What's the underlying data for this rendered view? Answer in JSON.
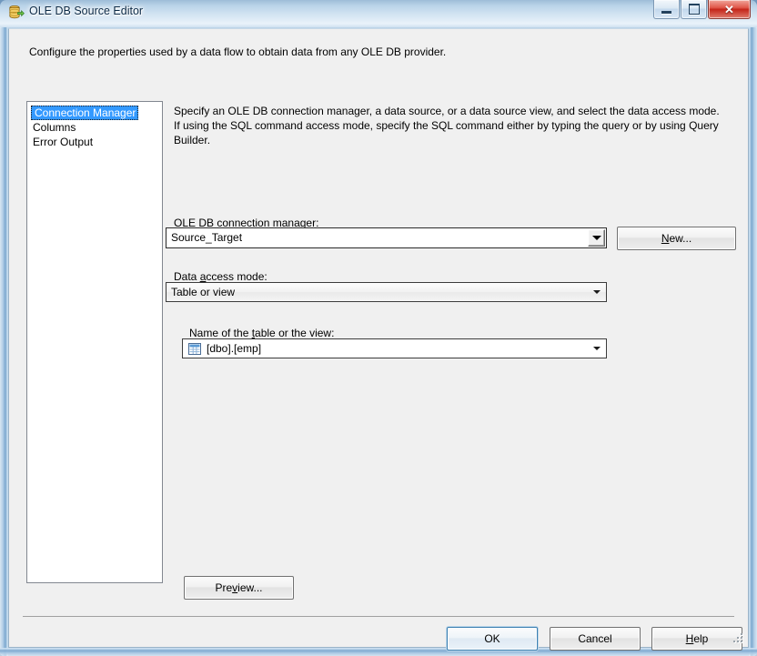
{
  "window": {
    "title": "OLE DB Source Editor",
    "icon": "ole-db-source-icon",
    "controls": {
      "minimize": "Minimize",
      "maximize": "Maximize",
      "close": "Close"
    }
  },
  "dialog": {
    "intro": "Configure the properties used by a data flow to obtain data from any OLE DB provider."
  },
  "nav": {
    "items": [
      {
        "label": "Connection Manager",
        "selected": true
      },
      {
        "label": "Columns",
        "selected": false
      },
      {
        "label": "Error Output",
        "selected": false
      }
    ]
  },
  "pane": {
    "description": "Specify an OLE DB connection manager, a data source, or a data source view, and select the data access mode. If using the SQL command access mode, specify the SQL command either by typing the query or by using Query Builder.",
    "connection_manager": {
      "label_pre": "OLE DB ",
      "label_accel": "c",
      "label_post": "onnection manager:",
      "value": "Source_Target",
      "dropdown_icon": "chevron-down-icon"
    },
    "new_button": {
      "label_pre": "",
      "label_accel": "N",
      "label_post": "ew..."
    },
    "data_access_mode": {
      "label_pre": "Data ",
      "label_accel": "a",
      "label_post": "ccess mode:",
      "value": "Table or view",
      "dropdown_icon": "chevron-down-icon"
    },
    "table_or_view": {
      "label_pre": "Name of the ",
      "label_accel": "t",
      "label_post": "able or the view:",
      "value": "[dbo].[emp]",
      "icon": "table-icon",
      "dropdown_icon": "chevron-down-icon"
    },
    "preview_button": {
      "label_pre": "Pre",
      "label_accel": "v",
      "label_post": "iew..."
    }
  },
  "footer": {
    "ok": {
      "label_pre": "OK",
      "label_accel": "",
      "label_post": ""
    },
    "cancel": {
      "label_pre": "Cancel",
      "label_accel": "",
      "label_post": ""
    },
    "help": {
      "label_pre": "",
      "label_accel": "H",
      "label_post": "elp"
    }
  },
  "colors": {
    "selection": "#3399ff",
    "dialog_bg": "#f0f0f0",
    "default_button_border": "#3c7fb1",
    "close_button": "#c4261a"
  }
}
